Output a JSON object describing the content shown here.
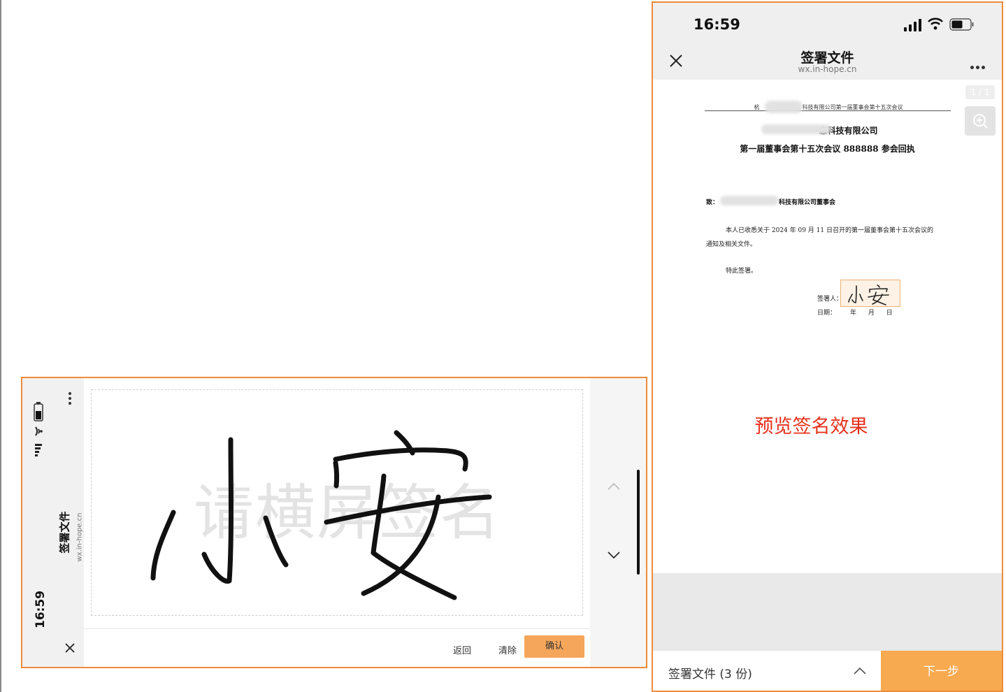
{
  "landscape": {
    "status": {
      "time": "16:59"
    },
    "header": {
      "title": "签署文件",
      "domain": "wx.in-hope.cn"
    },
    "pad": {
      "watermark": "请横屏签名",
      "signature_text": "小安"
    },
    "actions": {
      "back_label": "返回",
      "clear_label": "清除",
      "confirm_label": "确认"
    }
  },
  "portrait": {
    "status": {
      "time": "16:59"
    },
    "nav": {
      "title": "签署文件",
      "domain": "wx.in-hope.cn"
    },
    "page_indicator": "1 / 1",
    "document": {
      "header_line_prefix": "杭",
      "header_line": "科技有限公司第一届董事会第十五次会议",
      "title_line1": "息科技有限公司",
      "title_line2": "第一届董事会第十五次会议 888888 参会回执",
      "to_label": "致：",
      "to_org": "科技有限公司董事会",
      "body_line1": "本人已收悉关于 2024 年 09 月 11 日召开的第一届董事会第十五次会议的",
      "body_line2": "通知及相关文件。",
      "body_line3": "特此签署。",
      "signer_label": "签署人：",
      "date_label": "日期：",
      "date_fields": "年 月 日",
      "signature_text": "小安"
    },
    "annotation": "预览签名效果",
    "footer": {
      "files_label": "签署文件 (3 份)",
      "next_label": "下一步"
    }
  },
  "colors": {
    "accent_orange": "#f8aa50",
    "border_orange": "#ef8b3a",
    "annotation_red": "#e8301c"
  }
}
